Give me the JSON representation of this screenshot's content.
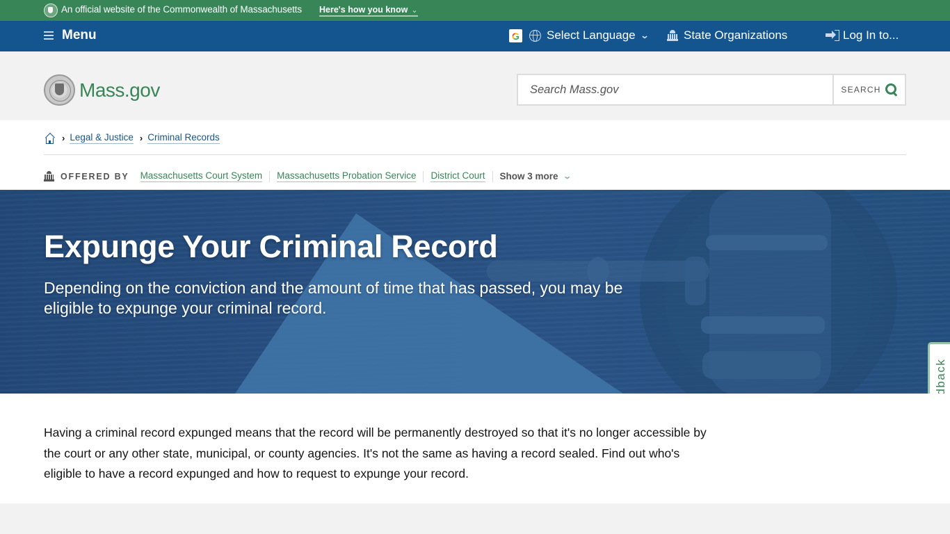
{
  "official_banner": {
    "text": "An official website of the Commonwealth of Massachusetts",
    "how_you_know": "Here's how you know",
    "icon": "state-seal-icon"
  },
  "utility_nav": {
    "menu_label": "Menu",
    "google_icon_letter": "G",
    "language_label": "Select Language",
    "state_orgs_label": "State Organizations",
    "login_label": "Log In to..."
  },
  "header": {
    "logo_text": "Mass.gov",
    "search": {
      "placeholder": "Search Mass.gov",
      "value": "",
      "button_label": "SEARCH"
    }
  },
  "breadcrumb": {
    "items": [
      {
        "label": "Legal & Justice"
      },
      {
        "label": "Criminal Records"
      }
    ]
  },
  "offered_by": {
    "label": "OFFERED BY",
    "orgs": [
      {
        "label": "Massachusetts Court System"
      },
      {
        "label": "Massachusetts Probation Service"
      },
      {
        "label": "District Court"
      }
    ],
    "show_more": "Show 3 more"
  },
  "hero": {
    "title": "Expunge Your Criminal Record",
    "lede": "Depending on the conviction and the amount of time that has passed, you may be eligible to expunge your criminal record."
  },
  "feedback": {
    "label": "Feedback"
  },
  "intro": {
    "text": "Having a criminal record expunged means that the record will be permanently destroyed so that it's no longer accessible by the court or any other state, municipal, or county agencies. It's not the same as having a record sealed. Find out who's eligible to have a record expunged and how to request to expunge your record."
  },
  "colors": {
    "brand_green": "#388557",
    "nav_blue": "#14558f",
    "hero_blue": "#27507f",
    "page_gray": "#f2f2f2"
  }
}
